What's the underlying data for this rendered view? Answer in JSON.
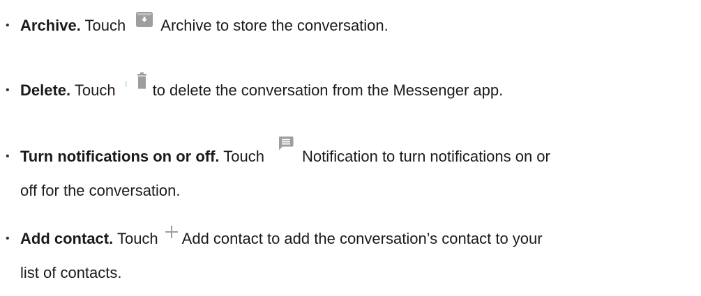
{
  "items": [
    {
      "title": "Archive.",
      "touch": "Touch",
      "icon": "archive-icon",
      "after": "Archive to store the conversation."
    },
    {
      "title": "Delete.",
      "touch": "Touch",
      "icon": "delete-icon",
      "after": "to delete the conversation from the Messenger app."
    },
    {
      "title": "Turn notifications on or off.",
      "touch": "Touch",
      "icon": "notification-icon",
      "after": "Notification to turn notifications on or",
      "after2": "off for the conversation."
    },
    {
      "title": "Add contact.",
      "touch": "Touch",
      "icon": "add-icon",
      "after": "Add contact to add the conversation’s contact to your",
      "after2": "list of contacts."
    }
  ],
  "colors": {
    "icon_gray": "#9e9e9e",
    "text": "#1a1a1a"
  }
}
